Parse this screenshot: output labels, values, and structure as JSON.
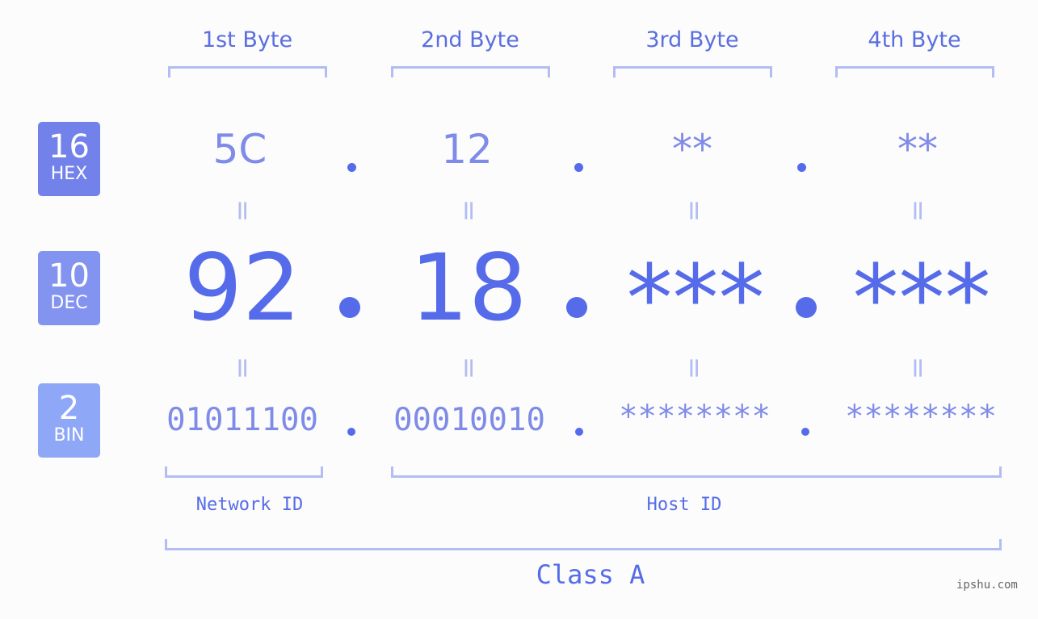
{
  "badges": [
    {
      "num": "16",
      "label": "HEX",
      "color": "#7282ea"
    },
    {
      "num": "10",
      "label": "DEC",
      "color": "#8393f0"
    },
    {
      "num": "2",
      "label": "BIN",
      "color": "#8fa7f7"
    }
  ],
  "bytes": [
    {
      "header": "1st Byte",
      "hex": "5C",
      "dec": "92",
      "bin": "01011100"
    },
    {
      "header": "2nd Byte",
      "hex": "12",
      "dec": "18",
      "bin": "00010010"
    },
    {
      "header": "3rd Byte",
      "hex": "**",
      "dec": "***",
      "bin": "********"
    },
    {
      "header": "4th Byte",
      "hex": "**",
      "dec": "***",
      "bin": "********"
    }
  ],
  "equals_sign": "=",
  "segments": {
    "network": "Network ID",
    "host": "Host ID"
  },
  "class_label": "Class A",
  "watermark": "ipshu.com"
}
